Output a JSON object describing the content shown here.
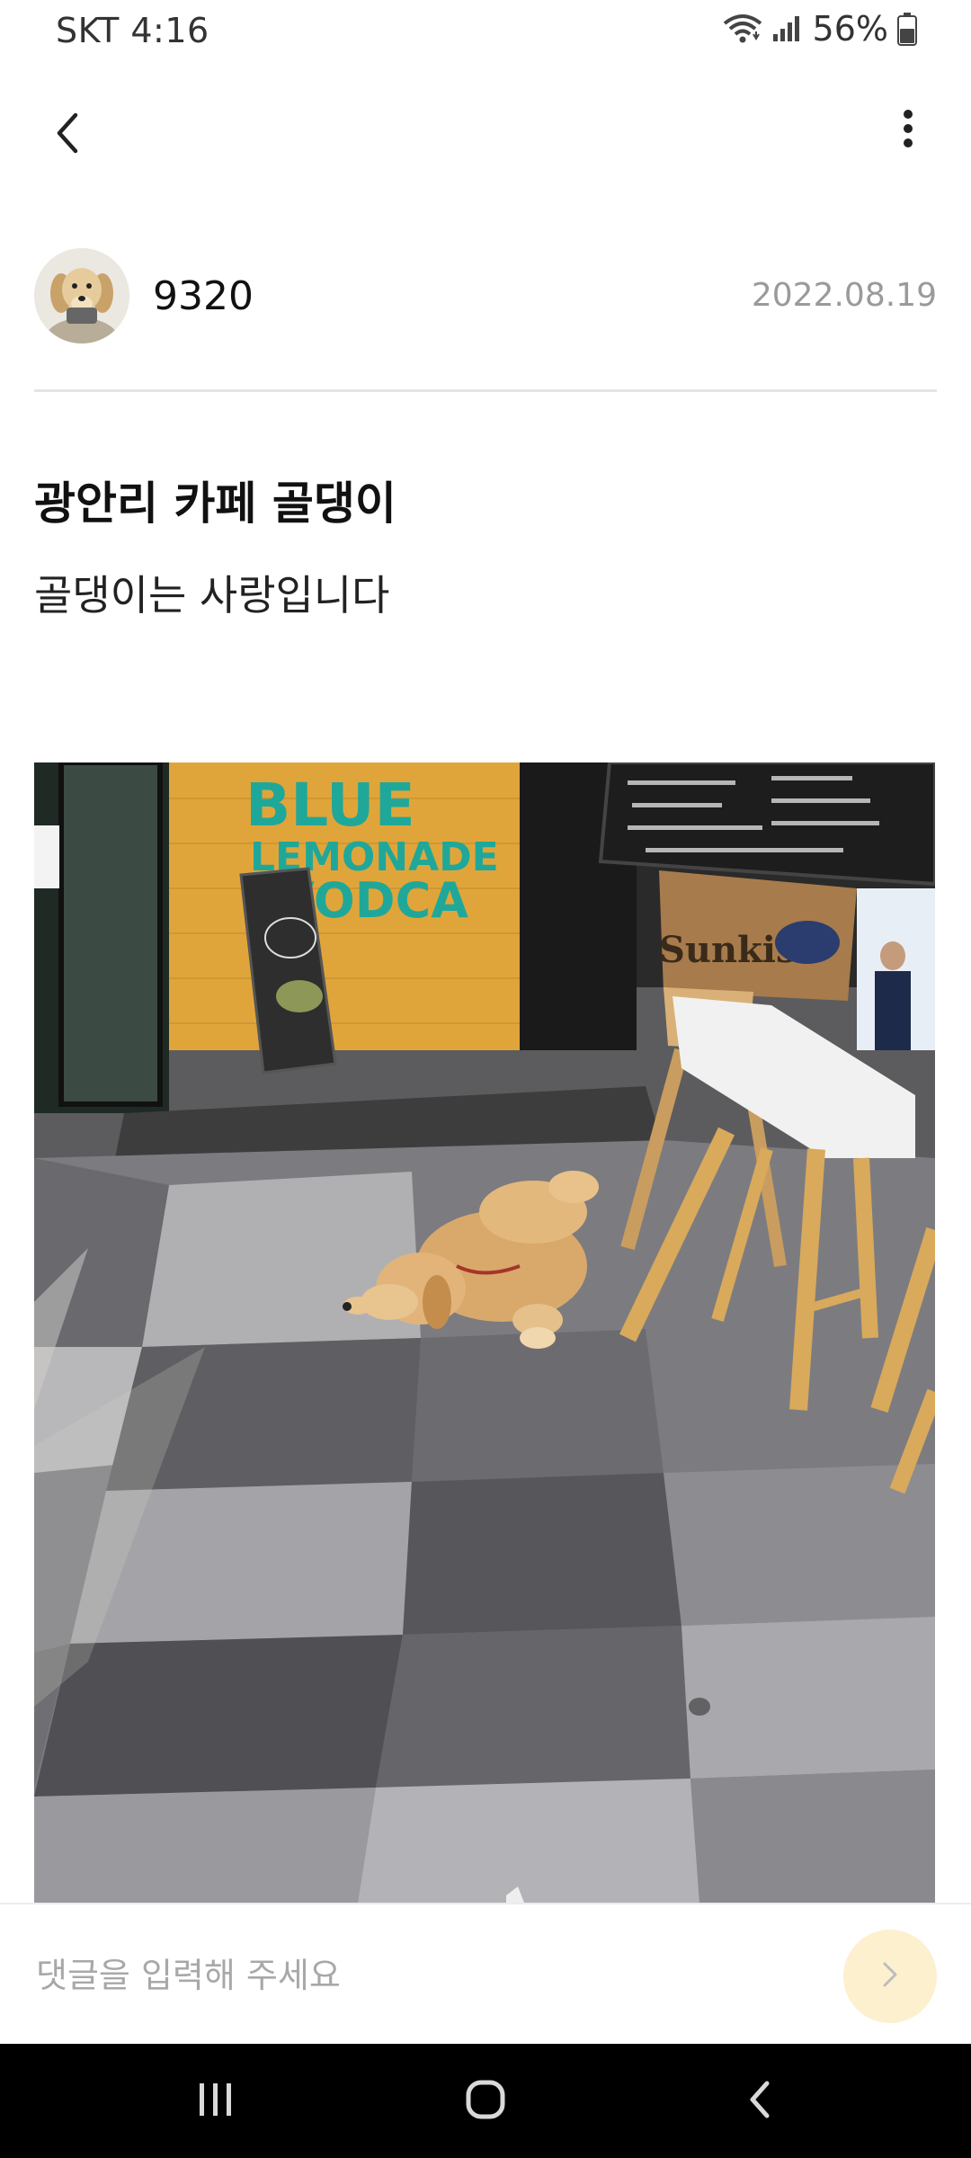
{
  "status_bar": {
    "carrier_time": "SKT 4:16",
    "battery_percent": "56%",
    "icons": [
      "wifi-icon",
      "signal-icon",
      "battery-icon"
    ]
  },
  "app_bar": {
    "back_icon": "chevron-left-icon",
    "more_icon": "more-vertical-icon"
  },
  "author": {
    "name": "9320",
    "date": "2022.08.19",
    "avatar": "golden-retriever-puppy-avatar"
  },
  "post": {
    "title": "광안리 카페 골댕이",
    "body": "골댕이는 사랑입니다",
    "photo": {
      "description": "golden-retriever-lying-outside-cafe",
      "signage": {
        "line1": "BLUE",
        "line2": "LEMONADE",
        "line3": "VODCA",
        "crate": "Sunkist"
      }
    }
  },
  "comment": {
    "placeholder": "댓글을 입력해 주세요",
    "send_icon": "chevron-right-icon",
    "accent_color": "#fdf0cf"
  },
  "nav_bar": {
    "icons": [
      "recent-apps-icon",
      "home-icon",
      "back-icon"
    ]
  }
}
